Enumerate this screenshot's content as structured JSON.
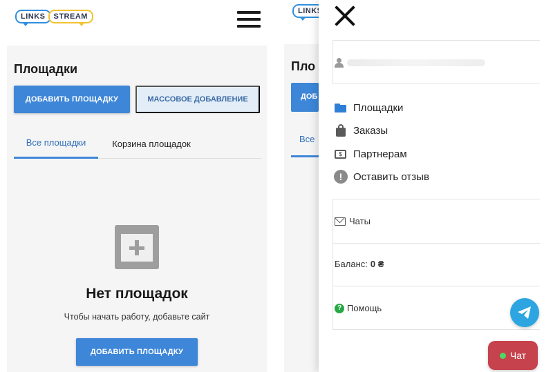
{
  "logo": {
    "word1": "LINKS",
    "word2": "STREAM"
  },
  "left": {
    "page_title": "Площадки",
    "add_button": "ДОБАВИТЬ ПЛОЩАДКУ",
    "bulk_button": "МАССОВОЕ ДОБАВЛЕНИЕ",
    "tabs": [
      "Все площадки",
      "Корзина площадок"
    ],
    "empty": {
      "title": "Нет площадок",
      "subtitle": "Чтобы начать работу, добавьте сайт",
      "button": "ДОБАВИТЬ ПЛОЩАДКУ"
    }
  },
  "right": {
    "bg_title": "Пло",
    "bg_button": "ДОБ",
    "bg_tab": "Все",
    "menu": [
      {
        "icon": "folder-icon",
        "label": "Площадки"
      },
      {
        "icon": "shopping-bag-icon",
        "label": "Заказы"
      },
      {
        "icon": "money-icon",
        "label": "Партнерам"
      },
      {
        "icon": "alert-circle-icon",
        "label": "Оставить отзыв"
      }
    ],
    "chats_label": "Чаты",
    "balance_label": "Баланс:",
    "balance_value": "0 ₴",
    "help_label": "Помощь",
    "chat_button": "Чат"
  },
  "colors": {
    "primary": "#3d86d8",
    "secondary_bg": "#e3edf8",
    "telegram": "#2ca5e0",
    "chat_button": "#c6424c",
    "online_dot": "#4cd964",
    "help": "#27a844"
  }
}
